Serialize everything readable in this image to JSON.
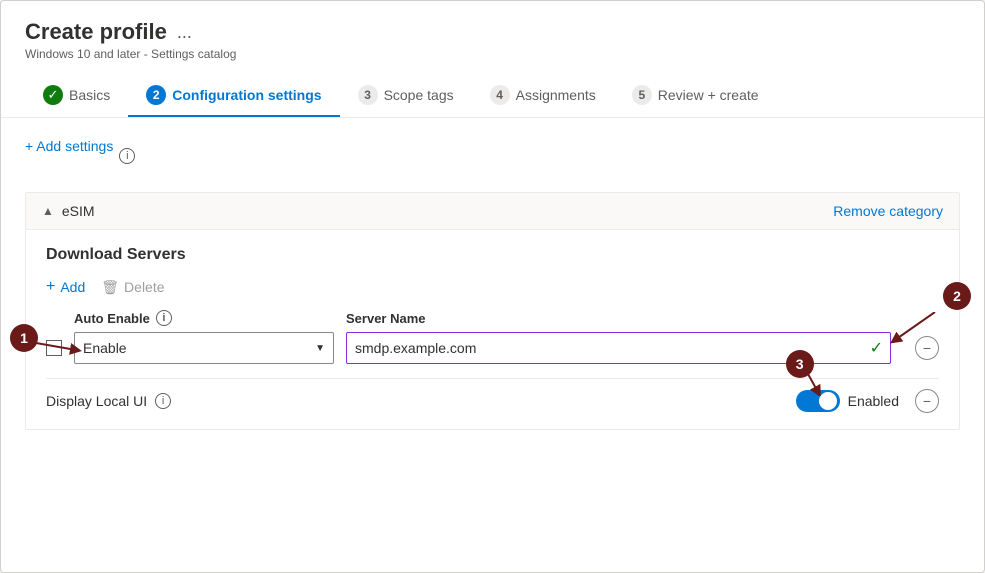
{
  "header": {
    "title": "Create profile",
    "subtitle": "Windows 10 and later - Settings catalog",
    "ellipsis": "..."
  },
  "tabs": [
    {
      "id": "basics",
      "label": "Basics",
      "num": null,
      "state": "completed"
    },
    {
      "id": "configuration",
      "label": "Configuration settings",
      "num": "2",
      "state": "active"
    },
    {
      "id": "scope",
      "label": "Scope tags",
      "num": "3",
      "state": "inactive"
    },
    {
      "id": "assignments",
      "label": "Assignments",
      "num": "4",
      "state": "inactive"
    },
    {
      "id": "review",
      "label": "Review + create",
      "num": "5",
      "state": "inactive"
    }
  ],
  "add_settings": "+ Add settings",
  "category": {
    "name": "eSIM",
    "remove_label": "Remove category"
  },
  "section": {
    "title": "Download Servers",
    "add_label": "Add",
    "delete_label": "Delete"
  },
  "table": {
    "col_auto_enable": "Auto Enable",
    "col_server_name": "Server Name",
    "row": {
      "dropdown_value": "Enable",
      "input_value": "smdp.example.com"
    }
  },
  "display_local": {
    "label": "Display Local UI",
    "toggle_state": "Enabled"
  },
  "badges": {
    "one": "1",
    "two": "2",
    "three": "3"
  }
}
